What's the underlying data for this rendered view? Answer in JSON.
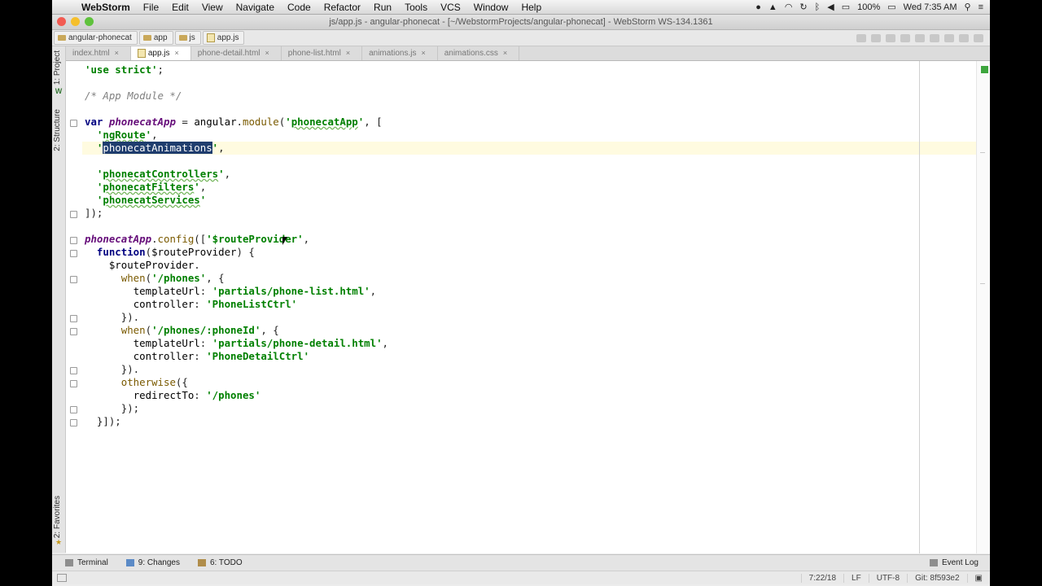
{
  "menubar": {
    "app_name": "WebStorm",
    "items": [
      "File",
      "Edit",
      "View",
      "Navigate",
      "Code",
      "Refactor",
      "Run",
      "Tools",
      "VCS",
      "Window",
      "Help"
    ],
    "battery": "100%",
    "clock": "Wed 7:35 AM"
  },
  "window": {
    "title": "js/app.js - angular-phonecat - [~/WebstormProjects/angular-phonecat] - WebStorm WS-134.1361"
  },
  "breadcrumbs": [
    "angular-phonecat",
    "app",
    "js",
    "app.js"
  ],
  "tabs": [
    {
      "label": "index.html",
      "active": false
    },
    {
      "label": "app.js",
      "active": true
    },
    {
      "label": "phone-detail.html",
      "active": false
    },
    {
      "label": "phone-list.html",
      "active": false
    },
    {
      "label": "animations.js",
      "active": false
    },
    {
      "label": "animations.css",
      "active": false
    }
  ],
  "side_tabs": {
    "project": "1: Project",
    "structure": "2: Structure",
    "favorites": "2: Favorites"
  },
  "code_lines": [
    "'use strict';",
    "",
    "/* App Module */",
    "",
    "var phonecatApp = angular.module('phonecatApp', [",
    "  'ngRoute',",
    "  'phonecatAnimations',",
    "",
    "  'phonecatControllers',",
    "  'phonecatFilters',",
    "  'phonecatServices'",
    "]);",
    "",
    "phonecatApp.config(['$routeProvider',",
    "  function($routeProvider) {",
    "    $routeProvider.",
    "      when('/phones', {",
    "        templateUrl: 'partials/phone-list.html',",
    "        controller: 'PhoneListCtrl'",
    "      }).",
    "      when('/phones/:phoneId', {",
    "        templateUrl: 'partials/phone-detail.html',",
    "        controller: 'PhoneDetailCtrl'",
    "      }).",
    "      otherwise({",
    "        redirectTo: '/phones'",
    "      });",
    "  }]);"
  ],
  "tool_windows": {
    "terminal": "Terminal",
    "changes": "9: Changes",
    "todo": "6: TODO",
    "event_log": "Event Log"
  },
  "status": {
    "position": "7:22/18",
    "line_sep": "LF",
    "encoding": "UTF-8",
    "git": "Git: 8f593e2"
  }
}
